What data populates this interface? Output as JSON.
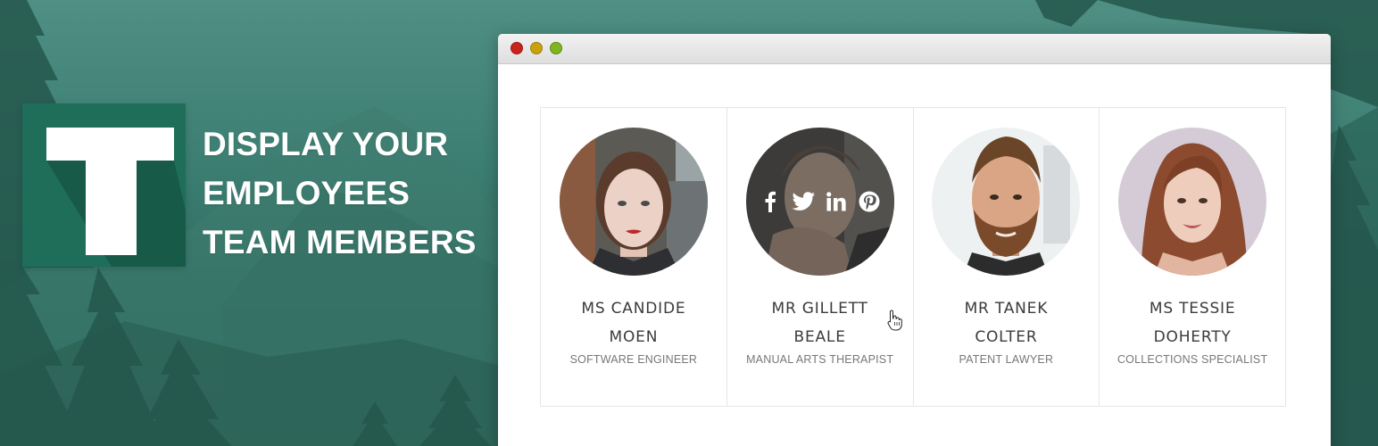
{
  "tagline": {
    "line1": "DISPLAY YOUR",
    "line2": "EMPLOYEES",
    "line3": "TEAM MEMBERS"
  },
  "logo": {
    "letter": "T",
    "color": "#1f6e59"
  },
  "window": {
    "controls": [
      "close",
      "minimize",
      "maximize"
    ],
    "colors": {
      "close": "#c8231c",
      "minimize": "#c9a10e",
      "maximize": "#7fb521"
    }
  },
  "team": [
    {
      "name_line1": "MS CANDIDE",
      "name_line2": "MOEN",
      "role": "SOFTWARE ENGINEER"
    },
    {
      "name_line1": "MR GILLETT",
      "name_line2": "BEALE",
      "role": "MANUAL ARTS THERAPIST",
      "social": [
        "facebook-icon",
        "twitter-icon",
        "linkedin-icon",
        "pinterest-icon"
      ]
    },
    {
      "name_line1": "MR TANEK",
      "name_line2": "COLTER",
      "role": "PATENT LAWYER"
    },
    {
      "name_line1": "MS TESSIE",
      "name_line2": "DOHERTY",
      "role": "COLLECTIONS SPECIALIST"
    }
  ],
  "cursor": "hand-pointer-icon"
}
